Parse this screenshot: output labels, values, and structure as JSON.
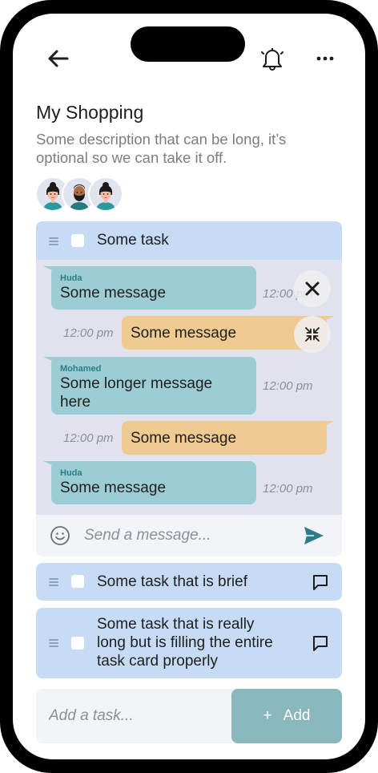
{
  "header": {
    "title": "My Shopping",
    "description": "Some description that can be long, it’s optional so we can take it off."
  },
  "icons": {
    "back": "arrow-left-icon",
    "notifications": "bell-icon",
    "more": "more-horizontal-icon"
  },
  "members": [
    {
      "name": "member-1",
      "type": "woman"
    },
    {
      "name": "member-2",
      "type": "bearded-man"
    },
    {
      "name": "member-3",
      "type": "woman"
    }
  ],
  "tasks": [
    {
      "label": "Some task",
      "checked": false,
      "expanded": true
    },
    {
      "label": "Some task that is brief",
      "checked": false
    },
    {
      "label": "Some task that is really long but is filling the entire task card properly",
      "checked": false
    }
  ],
  "chat": {
    "messages": [
      {
        "direction": "in",
        "sender": "Huda",
        "text": "Some message",
        "time": "12:00 pm"
      },
      {
        "direction": "out",
        "text": "Some message",
        "time": "12:00 pm"
      },
      {
        "direction": "in",
        "sender": "Mohamed",
        "text": "Some longer message here",
        "time": "12:00 pm"
      },
      {
        "direction": "out",
        "text": "Some message",
        "time": "12:00 pm"
      },
      {
        "direction": "in",
        "sender": "Huda",
        "text": "Some message",
        "time": "12:00 pm"
      }
    ],
    "placeholder": "Send a message..."
  },
  "add_task": {
    "placeholder": "Add a task...",
    "button_label": "Add",
    "button_icon": "+"
  },
  "colors": {
    "incoming": "#9dcdd4",
    "outgoing": "#efca91",
    "task_card": "#c7dcf4",
    "chat_bg": "#e0e3ee",
    "send": "#2a7e86",
    "add_button": "#89b8bd"
  }
}
